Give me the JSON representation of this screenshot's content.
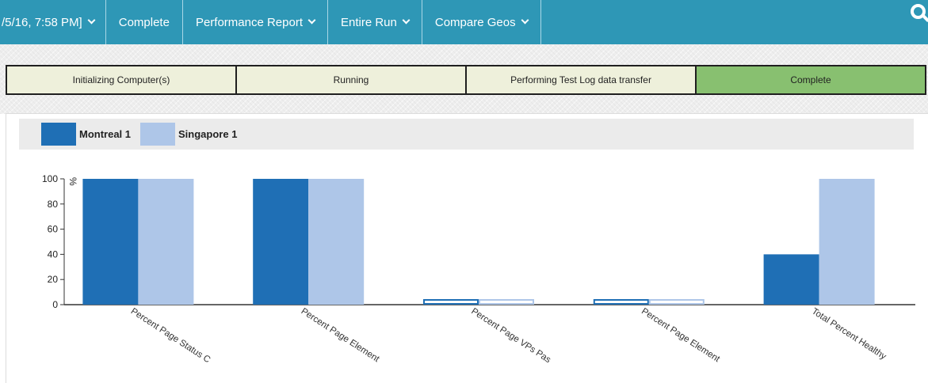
{
  "nav": {
    "items": [
      {
        "label": "/5/16, 7:58 PM]",
        "dropdown": true
      },
      {
        "label": "Complete",
        "dropdown": false
      },
      {
        "label": "Performance Report",
        "dropdown": true
      },
      {
        "label": "Entire Run",
        "dropdown": true
      },
      {
        "label": "Compare Geos",
        "dropdown": true
      }
    ],
    "search_icon": "search-icon",
    "bar_color": "#2e97b6"
  },
  "steps": [
    {
      "label": "Initializing Computer(s)",
      "active": false
    },
    {
      "label": "Running",
      "active": false
    },
    {
      "label": "Performing Test Log data transfer",
      "active": false
    },
    {
      "label": "Complete",
      "active": true
    }
  ],
  "step_colors": {
    "inactive": "#eef0db",
    "active": "#88c070"
  },
  "chart_data": {
    "type": "bar",
    "categories": [
      "Percent Page Status C",
      "Percent Page Element",
      "Percent Page VPs Pas",
      "Percent Page Element",
      "Total Percent Healthy"
    ],
    "series": [
      {
        "name": "Montreal 1",
        "values": [
          100,
          100,
          0,
          0,
          40
        ],
        "color": "#1f6fb5"
      },
      {
        "name": "Singapore 1",
        "values": [
          100,
          100,
          0,
          0,
          100
        ],
        "color": "#aec6e8"
      }
    ],
    "yticks": [
      0,
      20,
      40,
      60,
      80,
      100
    ],
    "ylim": [
      0,
      100
    ],
    "yunit": "%",
    "xlabel": "",
    "ylabel": "",
    "grid": false,
    "legend_position": "top-left"
  }
}
